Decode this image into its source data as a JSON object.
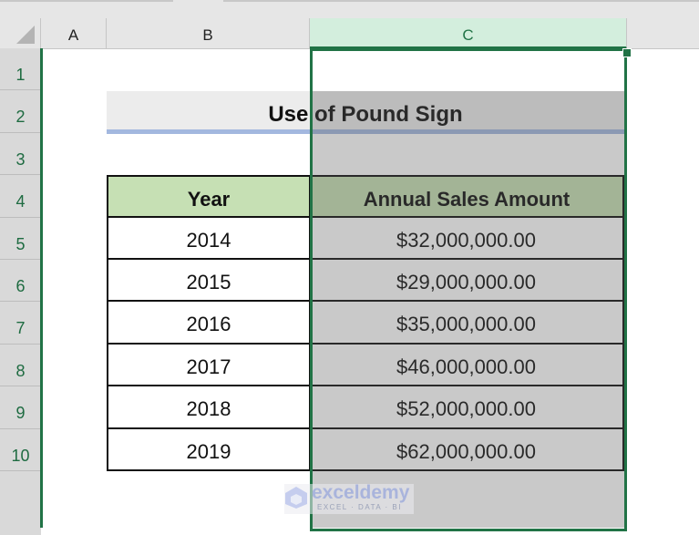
{
  "spreadsheet": {
    "column_headers": [
      "A",
      "B",
      "C"
    ],
    "row_headers": [
      "1",
      "2",
      "3",
      "4",
      "5",
      "6",
      "7",
      "8",
      "9",
      "10"
    ],
    "selected_column": "C",
    "colors": {
      "selection_border": "#217346",
      "selected_header_bg": "#d3eedd",
      "year_header_bg": "#c6e0b4",
      "amount_header_bg": "#a9c29b",
      "title_underline": "#a3b8df"
    }
  },
  "table": {
    "title": "Use of Pound Sign",
    "headers": [
      "Year",
      "Annual Sales Amount"
    ],
    "rows": [
      {
        "year": "2014",
        "amount": "$32,000,000.00"
      },
      {
        "year": "2015",
        "amount": "$29,000,000.00"
      },
      {
        "year": "2016",
        "amount": "$35,000,000.00"
      },
      {
        "year": "2017",
        "amount": "$46,000,000.00"
      },
      {
        "year": "2018",
        "amount": "$52,000,000.00"
      },
      {
        "year": "2019",
        "amount": "$62,000,000.00"
      }
    ]
  },
  "watermark": {
    "name": "exceldemy",
    "tagline": "EXCEL · DATA · BI"
  }
}
